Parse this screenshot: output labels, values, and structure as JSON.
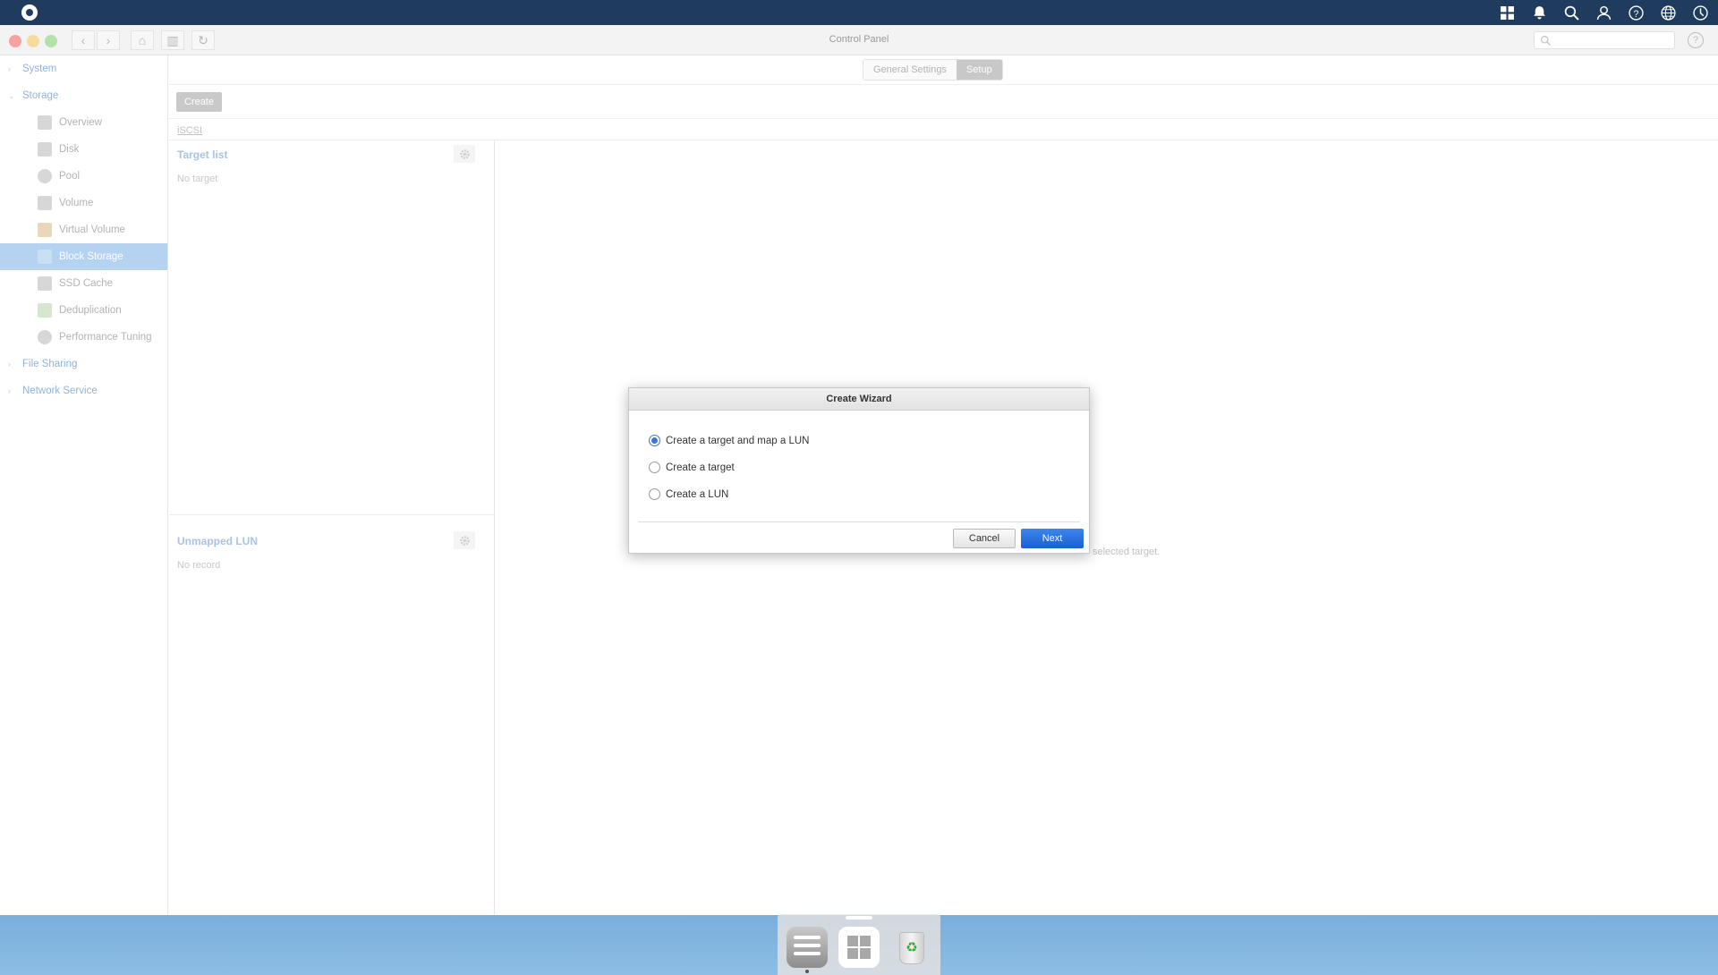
{
  "window": {
    "title": "Control Panel"
  },
  "sidebar": {
    "groups": [
      {
        "label": "System"
      },
      {
        "label": "Storage"
      },
      {
        "label": "File Sharing"
      },
      {
        "label": "Network Service"
      }
    ],
    "storage_items": [
      {
        "label": "Overview",
        "icon": "overview-icon"
      },
      {
        "label": "Disk",
        "icon": "disk-icon"
      },
      {
        "label": "Pool",
        "icon": "pool-icon"
      },
      {
        "label": "Volume",
        "icon": "volume-icon"
      },
      {
        "label": "Virtual Volume",
        "icon": "virtual-volume-icon"
      },
      {
        "label": "Block Storage",
        "icon": "block-storage-icon",
        "active": true
      },
      {
        "label": "SSD Cache",
        "icon": "ssd-cache-icon"
      },
      {
        "label": "Deduplication",
        "icon": "deduplication-icon"
      },
      {
        "label": "Performance Tuning",
        "icon": "performance-tuning-icon"
      }
    ]
  },
  "tabs": {
    "general": "General Settings",
    "setup": "Setup",
    "active": "Setup"
  },
  "toolbar": {
    "create_label": "Create"
  },
  "subtab": {
    "iscsi": "iSCSI"
  },
  "target_list": {
    "title": "Target list",
    "empty": "No target"
  },
  "unmapped_lun": {
    "title": "Unmapped LUN",
    "empty": "No record"
  },
  "right_pane": {
    "partial_message": "selected target."
  },
  "dialog": {
    "title": "Create Wizard",
    "options": [
      {
        "label": "Create a target and map a LUN",
        "checked": true
      },
      {
        "label": "Create a target",
        "checked": false
      },
      {
        "label": "Create a LUN",
        "checked": false
      }
    ],
    "cancel_label": "Cancel",
    "next_label": "Next"
  },
  "colors": {
    "accent": "#1b5fd0",
    "sidebar_active": "#b5d2f0",
    "topbar": "#1f3c5e"
  }
}
